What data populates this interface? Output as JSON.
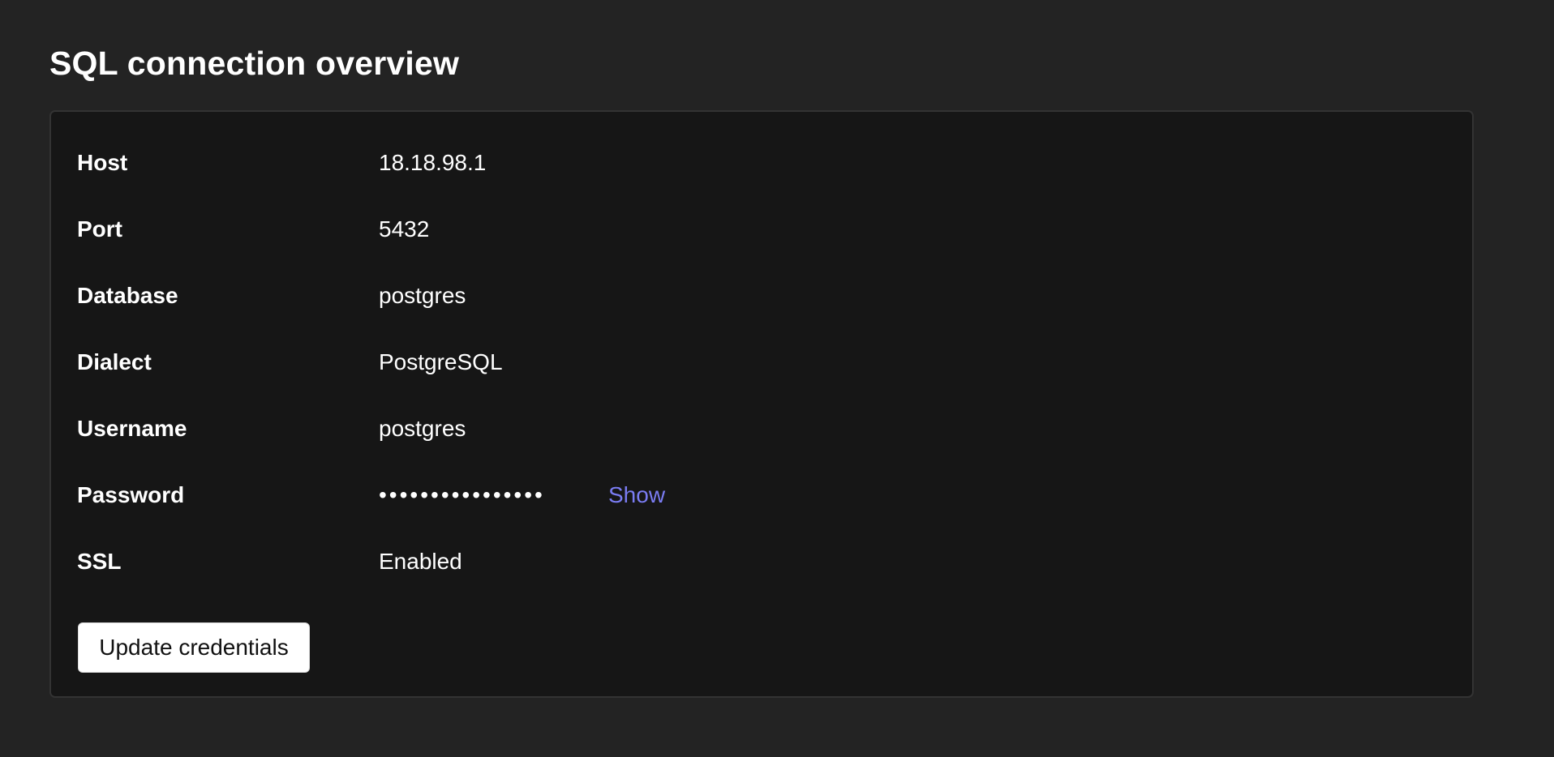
{
  "page": {
    "title": "SQL connection overview"
  },
  "connection": {
    "rows": [
      {
        "label": "Host",
        "value": "18.18.98.1"
      },
      {
        "label": "Port",
        "value": "5432"
      },
      {
        "label": "Database",
        "value": "postgres"
      },
      {
        "label": "Dialect",
        "value": "PostgreSQL"
      },
      {
        "label": "Username",
        "value": "postgres"
      },
      {
        "label": "Password",
        "value": "••••••••••••••••",
        "action_label": "Show"
      },
      {
        "label": "SSL",
        "value": "Enabled"
      }
    ]
  },
  "actions": {
    "update_label": "Update credentials"
  },
  "colors": {
    "page_background": "#232323",
    "panel_background": "#161616",
    "panel_border": "#333333",
    "link": "#7a7cf2",
    "button_background": "#ffffff"
  }
}
